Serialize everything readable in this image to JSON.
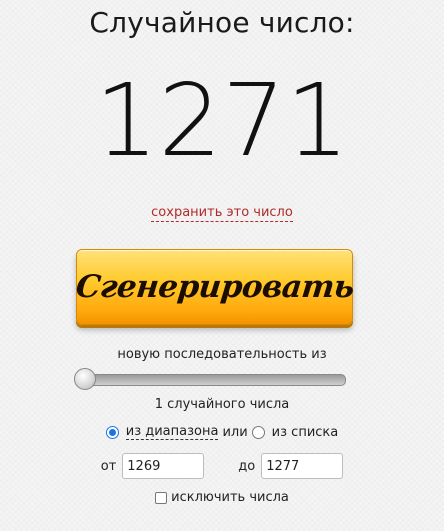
{
  "header": {
    "title": "Случайное число:"
  },
  "result": {
    "number": "1271"
  },
  "save": {
    "label": "сохранить это число"
  },
  "generate": {
    "label": "Сгенерировать"
  },
  "sequence": {
    "label": "новую последовательность из",
    "count_text": "1 случайного числа",
    "slider_value": 1
  },
  "mode": {
    "range_label": "из диапазона",
    "or_label": "или",
    "list_label": "из списка",
    "selected": "range"
  },
  "range": {
    "from_label": "от",
    "from_value": "1269",
    "to_label": "до",
    "to_value": "1277"
  },
  "exclude": {
    "label": "исключить числа",
    "checked": false
  },
  "colors": {
    "accent_link": "#b22a2a",
    "button_top": "#ffe27a",
    "button_bottom": "#f59300",
    "radio_selected": "#1a73e8"
  }
}
